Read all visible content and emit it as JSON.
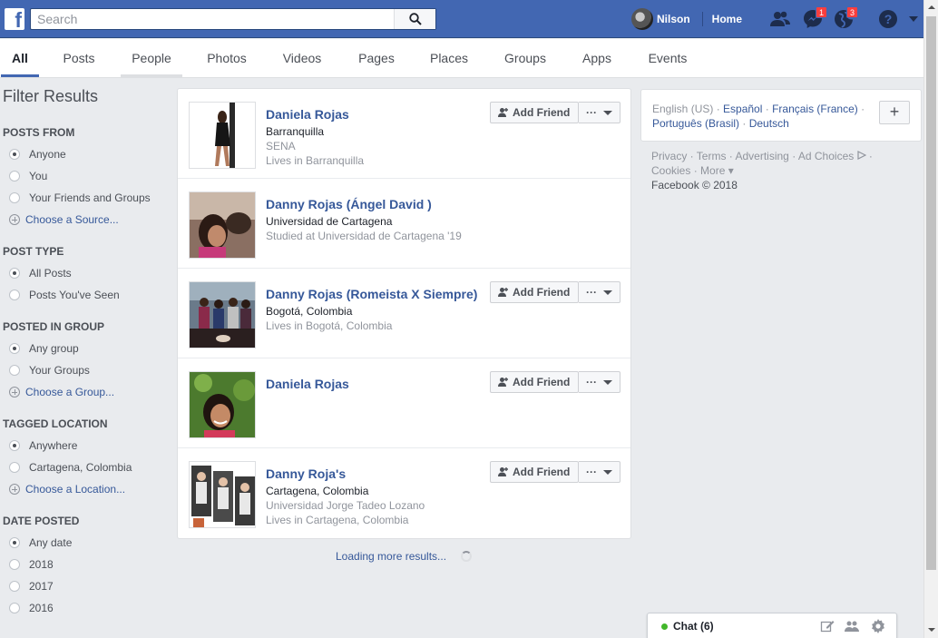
{
  "brand": {
    "logo_letter": "f",
    "color": "#4267b2"
  },
  "search": {
    "placeholder": "Search",
    "value": ""
  },
  "topbar": {
    "user_name": "Nilson",
    "home_label": "Home",
    "messages_count": "1",
    "notifications_count": "3"
  },
  "tabs": [
    "All",
    "Posts",
    "People",
    "Photos",
    "Videos",
    "Pages",
    "Places",
    "Groups",
    "Apps",
    "Events"
  ],
  "filters": {
    "title": "Filter Results",
    "groups": [
      {
        "heading": "POSTS FROM",
        "options": [
          "Anyone",
          "You",
          "Your Friends and Groups"
        ],
        "selected": "Anyone",
        "link": "Choose a Source..."
      },
      {
        "heading": "POST TYPE",
        "options": [
          "All Posts",
          "Posts You've Seen"
        ],
        "selected": "All Posts"
      },
      {
        "heading": "POSTED IN GROUP",
        "options": [
          "Any group",
          "Your Groups"
        ],
        "selected": "Any group",
        "link": "Choose a Group..."
      },
      {
        "heading": "TAGGED LOCATION",
        "options": [
          "Anywhere",
          "Cartagena, Colombia"
        ],
        "selected": "Anywhere",
        "link": "Choose a Location..."
      },
      {
        "heading": "DATE POSTED",
        "options": [
          "Any date",
          "2018",
          "2017",
          "2016"
        ],
        "selected": "Any date"
      }
    ]
  },
  "results": [
    {
      "name": "Daniela Rojas",
      "lines": [
        "Barranquilla",
        "SENA",
        "Lives in Barranquilla"
      ],
      "add_friend": true
    },
    {
      "name": "Danny Rojas (Ángel David )",
      "lines": [
        "Universidad de Cartagena",
        "Studied at Universidad de Cartagena '19"
      ],
      "add_friend": false
    },
    {
      "name": "Danny Rojas (Romeista X Siempre)",
      "lines": [
        "Bogotá, Colombia",
        "Lives in Bogotá, Colombia"
      ],
      "add_friend": true
    },
    {
      "name": "Daniela Rojas",
      "lines": [],
      "add_friend": true
    },
    {
      "name": "Danny Roja's",
      "lines": [
        "Cartagena, Colombia",
        "Universidad Jorge Tadeo Lozano",
        "Lives in Cartagena, Colombia"
      ],
      "add_friend": true
    }
  ],
  "add_friend_label": "Add Friend",
  "more_label": "···",
  "loading_text": "Loading more results...",
  "languages": {
    "current": "English (US)",
    "others": [
      "Español",
      "Français (France)",
      "Português (Brasil)",
      "Deutsch"
    ],
    "plus": "+"
  },
  "footer": {
    "links": [
      "Privacy",
      "Terms",
      "Advertising",
      "Ad Choices",
      "Cookies",
      "More"
    ],
    "copyright": "Facebook © 2018"
  },
  "chat": {
    "label": "Chat (6)"
  }
}
